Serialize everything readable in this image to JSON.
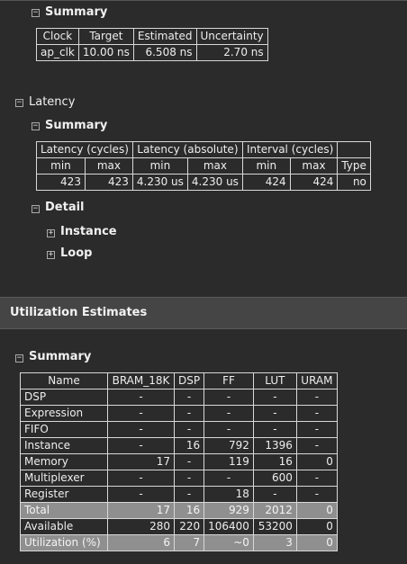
{
  "timing": {
    "summary_label": "Summary",
    "headers": [
      "Clock",
      "Target",
      "Estimated",
      "Uncertainty"
    ],
    "row": [
      "ap_clk",
      "10.00 ns",
      "6.508 ns",
      "2.70 ns"
    ]
  },
  "latency": {
    "title": "Latency",
    "summary_label": "Summary",
    "group_headers": [
      "Latency (cycles)",
      "Latency (absolute)",
      "Interval (cycles)",
      ""
    ],
    "sub_headers": [
      "min",
      "max",
      "min",
      "max",
      "min",
      "max",
      "Type"
    ],
    "row": [
      "423",
      "423",
      "4.230 us",
      "4.230 us",
      "424",
      "424",
      "no"
    ],
    "detail_label": "Detail",
    "instance_label": "Instance",
    "loop_label": "Loop"
  },
  "utilization": {
    "banner": "Utilization Estimates",
    "summary_label": "Summary",
    "headers": [
      "Name",
      "BRAM_18K",
      "DSP",
      "FF",
      "LUT",
      "URAM"
    ],
    "rows": [
      [
        "DSP",
        "-",
        "-",
        "-",
        "-",
        "-"
      ],
      [
        "Expression",
        "-",
        "-",
        "-",
        "-",
        "-"
      ],
      [
        "FIFO",
        "-",
        "-",
        "-",
        "-",
        "-"
      ],
      [
        "Instance",
        "-",
        "16",
        "792",
        "1396",
        "-"
      ],
      [
        "Memory",
        "17",
        "-",
        "119",
        "16",
        "0"
      ],
      [
        "Multiplexer",
        "-",
        "-",
        "-",
        "600",
        "-"
      ],
      [
        "Register",
        "-",
        "-",
        "18",
        "-",
        "-"
      ],
      [
        "Total",
        "17",
        "16",
        "929",
        "2012",
        "0"
      ],
      [
        "Available",
        "280",
        "220",
        "106400",
        "53200",
        "0"
      ],
      [
        "Utilization (%)",
        "6",
        "7",
        "~0",
        "3",
        "0"
      ]
    ]
  },
  "icons": {
    "collapse": "⊟",
    "expand": "⊞"
  }
}
